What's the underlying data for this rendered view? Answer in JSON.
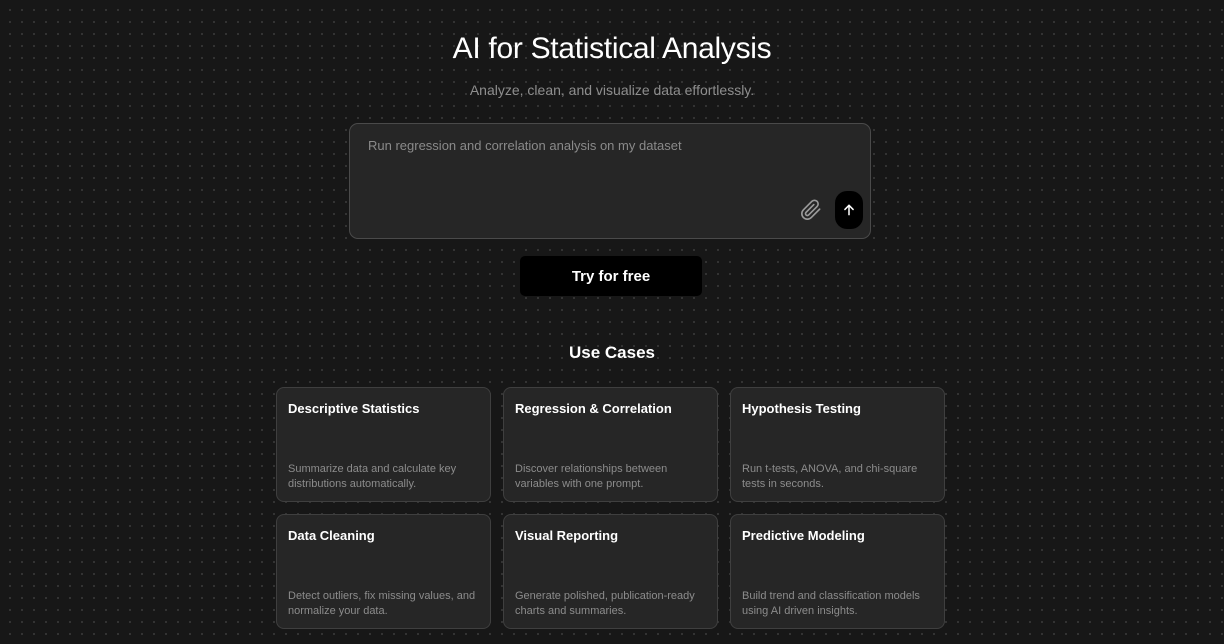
{
  "hero": {
    "title": "AI for Statistical Analysis",
    "subtitle": "Analyze, clean, and visualize data effortlessly."
  },
  "prompt": {
    "placeholder": "Run regression and correlation analysis on my dataset",
    "attach_icon": "paperclip-icon",
    "send_icon": "arrow-up-icon"
  },
  "cta": {
    "label": "Try for free"
  },
  "use_cases": {
    "title": "Use Cases",
    "cards": [
      {
        "title": "Descriptive Statistics",
        "description": "Summarize data and calculate key distributions automatically."
      },
      {
        "title": "Regression & Correlation",
        "description": "Discover relationships between variables with one prompt."
      },
      {
        "title": "Hypothesis Testing",
        "description": "Run t-tests, ANOVA, and chi-square tests in seconds."
      },
      {
        "title": "Data Cleaning",
        "description": "Detect outliers, fix missing values, and normalize your data."
      },
      {
        "title": "Visual Reporting",
        "description": "Generate polished, publication-ready charts and summaries."
      },
      {
        "title": "Predictive Modeling",
        "description": "Build trend and classification models using AI driven insights."
      }
    ]
  },
  "colors": {
    "background": "#171717",
    "surface": "#262626",
    "border": "#4a4a4a",
    "button": "#000000",
    "text_primary": "#ffffff",
    "text_muted": "#8c8c8c"
  }
}
